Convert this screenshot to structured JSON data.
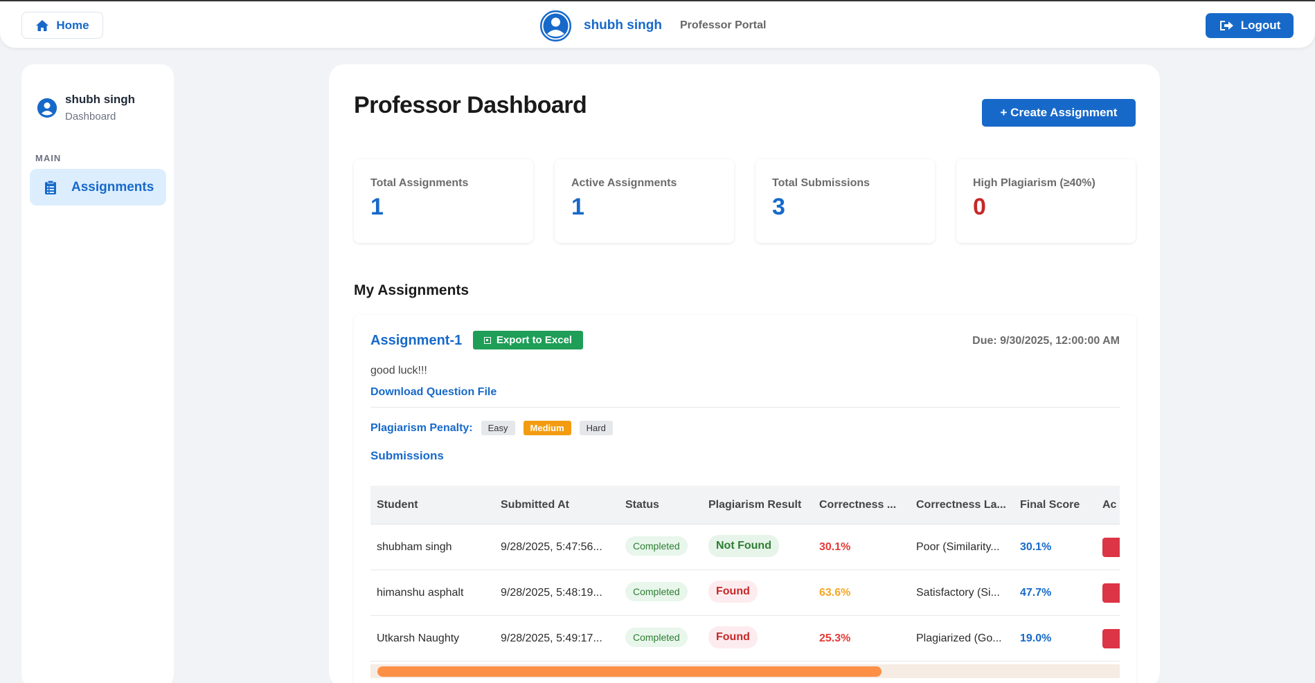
{
  "topbar": {
    "home_label": "Home",
    "user_name": "shubh singh",
    "portal_label": "Professor Portal",
    "logout_label": "Logout"
  },
  "sidebar": {
    "user_name": "shubh singh",
    "user_sub": "Dashboard",
    "section_label": "MAIN",
    "items": [
      {
        "label": "Assignments",
        "icon": "clipboard-icon",
        "active": true
      }
    ]
  },
  "main": {
    "title": "Professor Dashboard",
    "create_label": "+ Create Assignment",
    "stats": [
      {
        "label": "Total Assignments",
        "value": "1"
      },
      {
        "label": "Active Assignments",
        "value": "1"
      },
      {
        "label": "Total Submissions",
        "value": "3"
      },
      {
        "label": "High Plagiarism (≥40%)",
        "value": "0"
      }
    ],
    "section_title": "My Assignments"
  },
  "assignment": {
    "title": "Assignment-1",
    "export_label": "Export to Excel",
    "due": "Due: 9/30/2025, 12:00:00 AM",
    "description": "good luck!!!",
    "download_label": "Download Question File",
    "penalty_label": "Plagiarism Penalty:",
    "penalty_options": [
      "Easy",
      "Medium",
      "Hard"
    ],
    "penalty_selected": "Medium",
    "submissions_label": "Submissions",
    "columns": [
      "Student",
      "Submitted At",
      "Status",
      "Plagiarism Result",
      "Correctness ...",
      "Correctness La...",
      "Final Score",
      "Ac"
    ],
    "rows": [
      {
        "student": "shubham singh",
        "submitted_at": "9/28/2025, 5:47:56...",
        "status": "Completed",
        "plagiarism": "Not Found",
        "correctness": "30.1%",
        "correctness_label": "Poor (Similarity...",
        "final_score": "30.1%"
      },
      {
        "student": "himanshu asphalt",
        "submitted_at": "9/28/2025, 5:48:19...",
        "status": "Completed",
        "plagiarism": "Found",
        "correctness": "63.6%",
        "correctness_label": "Satisfactory (Si...",
        "final_score": "47.7%"
      },
      {
        "student": "Utkarsh Naughty",
        "submitted_at": "9/28/2025, 5:49:17...",
        "status": "Completed",
        "plagiarism": "Found",
        "correctness": "25.3%",
        "correctness_label": "Plagiarized (Go...",
        "final_score": "19.0%"
      }
    ]
  },
  "colors": {
    "primary": "#1769c9",
    "success": "#1e9e57",
    "danger": "#dc3545",
    "warning": "#f39c12",
    "correctness_low": "#e53935",
    "correctness_mid": "#f5a623"
  }
}
